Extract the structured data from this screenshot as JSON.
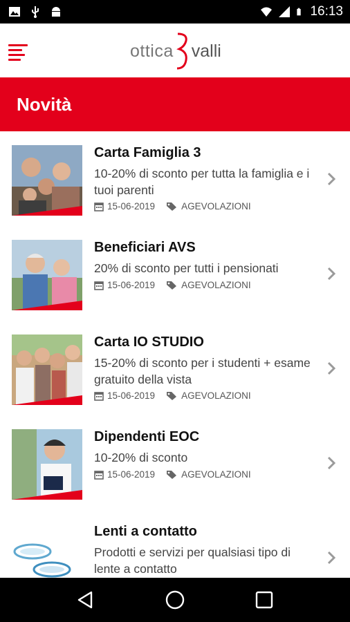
{
  "status_bar": {
    "time": "16:13"
  },
  "header": {
    "logo_left": "ottica",
    "logo_right": "valli"
  },
  "section": {
    "title": "Novità"
  },
  "news": [
    {
      "title": "Carta Famiglia 3",
      "description": "10-20% di sconto per tutta la famiglia e i tuoi parenti",
      "date": "15-06-2019",
      "category": "AGEVOLAZIONI"
    },
    {
      "title": "Beneficiari AVS",
      "description": "20% di sconto per tutti i pensionati",
      "date": "15-06-2019",
      "category": "AGEVOLAZIONI"
    },
    {
      "title": "Carta IO STUDIO",
      "description": "15-20% di sconto per i studenti + esame gratuito della vista",
      "date": "15-06-2019",
      "category": "AGEVOLAZIONI"
    },
    {
      "title": "Dipendenti EOC",
      "description": "10-20% di sconto",
      "date": "15-06-2019",
      "category": "AGEVOLAZIONI"
    },
    {
      "title": "Lenti a contatto",
      "description": "Prodotti e servizi per qualsiasi tipo di lente a contatto"
    }
  ],
  "icons": {
    "menu": "hamburger-menu-icon",
    "calendar": "calendar-icon",
    "tag": "tag-icon",
    "chevron": "chevron-right-icon",
    "nav_back": "back-triangle-icon",
    "nav_home": "home-circle-icon",
    "nav_recents": "recents-square-icon"
  },
  "colors": {
    "brand": "#e3001b",
    "status_bar": "#000000",
    "text": "#111111"
  }
}
